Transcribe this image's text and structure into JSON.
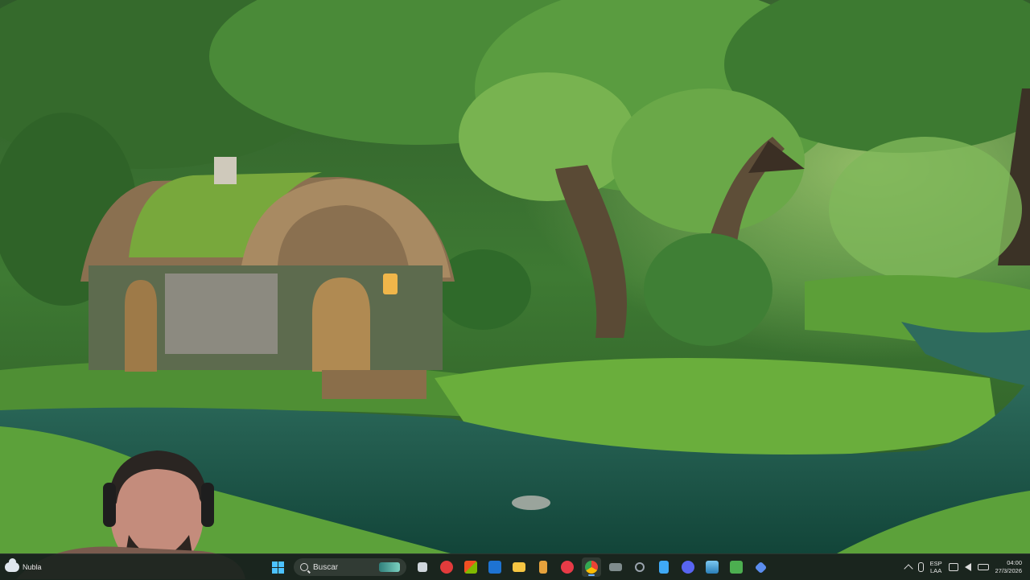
{
  "desktop": {
    "wallpaper": "forest-cottage-river-wallpaper"
  },
  "taskbar": {
    "weather_label": "Nubla",
    "search_placeholder": "Buscar",
    "apps": [
      {
        "name": "task-view",
        "color": "#cfd6dc"
      },
      {
        "name": "app-red",
        "color": "#e23b3b"
      },
      {
        "name": "microsoft-store",
        "color": "#f2c94c"
      },
      {
        "name": "outlook",
        "color": "#1e73d2"
      },
      {
        "name": "file-explorer",
        "color": "#f5c542"
      },
      {
        "name": "app-orange",
        "color": "#e6a23c"
      },
      {
        "name": "media-player",
        "color": "#e83b47"
      },
      {
        "name": "chrome",
        "color": "#4285f4"
      },
      {
        "name": "app-gray",
        "color": "#7f8c8d"
      },
      {
        "name": "app-dark",
        "color": "#9aa4ad"
      },
      {
        "name": "notepad",
        "color": "#3fa9f5"
      },
      {
        "name": "discord",
        "color": "#5865f2"
      },
      {
        "name": "photos",
        "color": "#3aa0d8"
      },
      {
        "name": "app-green",
        "color": "#4caf50"
      },
      {
        "name": "app-blue",
        "color": "#5b8def"
      }
    ],
    "language_primary": "ESP",
    "language_secondary": "LAA",
    "time": "04:00",
    "date": "27/3/2026"
  }
}
